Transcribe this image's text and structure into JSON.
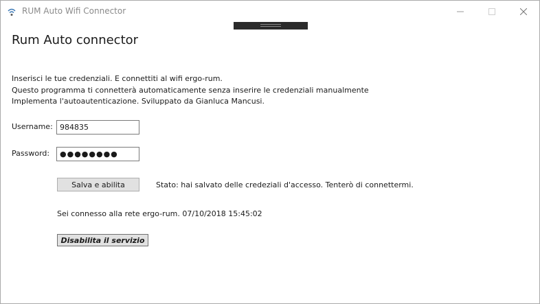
{
  "window": {
    "title": "RUM Auto Wifi Connector",
    "icons": {
      "app": "wifi-app-icon",
      "minimize": "minimize-icon",
      "maximize": "maximize-icon",
      "close": "close-icon"
    }
  },
  "main": {
    "heading": "Rum Auto connector",
    "description": [
      "Inserisci le tue credenziali. E connettiti al wifi ergo-rum.",
      "Questo programma ti connetterà automaticamente senza inserire le credenziali manualmente",
      "Implementa l'autoautenticazione. Sviluppato da Gianluca Mancusi."
    ],
    "username_label": "Username:",
    "username_value": "984835",
    "password_label": "Password:",
    "password_value": "●●●●●●●●",
    "save_button": "Salva e abilita",
    "status_text": "Stato: hai salvato delle credeziali d'accesso. Tenterò di connettermi.",
    "connection_text": "Sei connesso alla rete ergo-rum. 07/10/2018 15:45:02",
    "disable_button": "Disabilita il servizio"
  },
  "colors": {
    "button_bg": "#e1e1e1",
    "handle_bg": "#2b2b2b",
    "title_text": "#8a8a8a"
  }
}
